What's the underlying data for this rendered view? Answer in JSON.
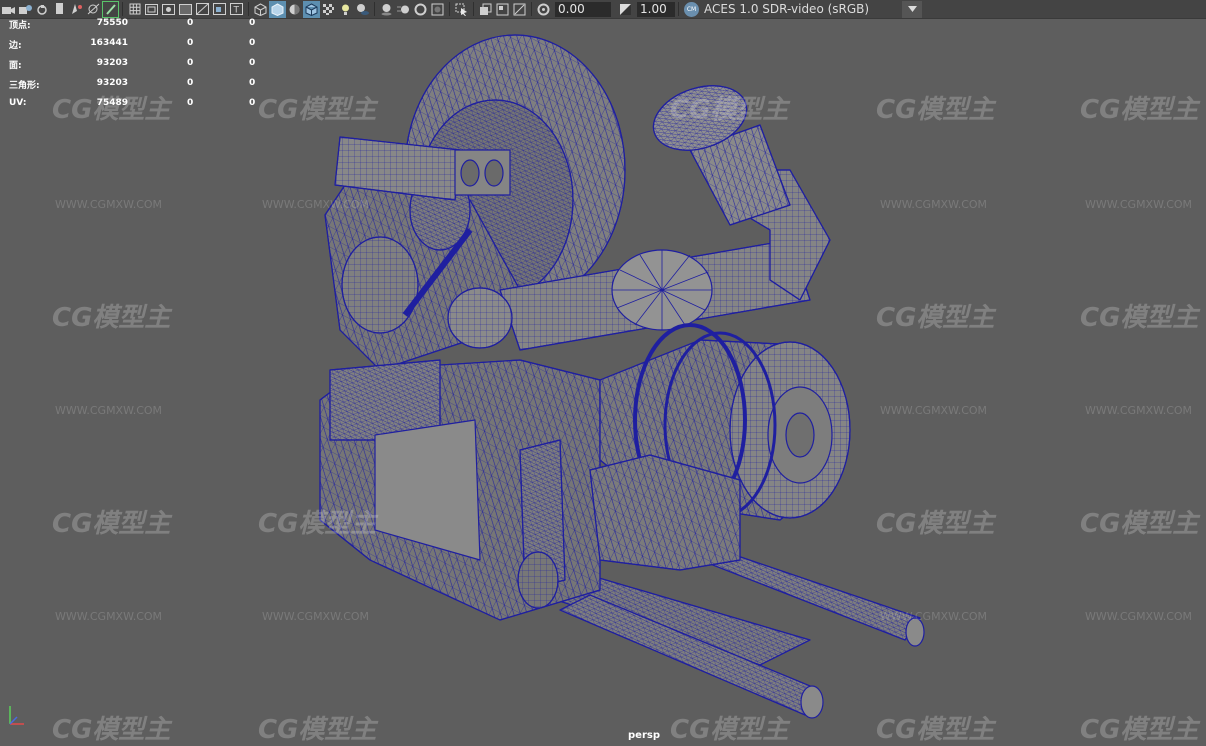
{
  "toolbar": {
    "exposure_value": "0.00",
    "gamma_value": "1.00",
    "color_space_badge": "CM",
    "color_space": "ACES 1.0 SDR-video (sRGB)",
    "icons": [
      "camera-icon",
      "camera-attribute-icon",
      "bookmark-icon",
      "image-plane-icon",
      "2d-pan-icon",
      "grease-pencil-icon",
      "grid-icon",
      "film-gate-icon",
      "resolution-gate-icon",
      "gate-mask-icon",
      "field-chart-icon",
      "safe-action-icon",
      "safe-title-icon",
      "wireframe-icon",
      "smooth-shade-icon",
      "use-default-material-icon",
      "wireframe-on-shaded-icon",
      "xray-icon",
      "lights-icon",
      "shadows-icon",
      "screen-space-ao-icon",
      "motion-blur-icon",
      "multisample-aa-icon",
      "depth-of-field-icon",
      "isolate-select-icon",
      "xray-joints-icon",
      "xray-active-icon",
      "two-sided-lighting-icon",
      "exposure-icon",
      "gamma-icon",
      "color-management-icon"
    ],
    "accent_active": "#59c36a",
    "accent_on": "#5d8fb0"
  },
  "hud": {
    "rows": [
      {
        "label": "顶点:",
        "v1": "75550",
        "v2": "0",
        "v3": "0"
      },
      {
        "label": "边:",
        "v1": "163441",
        "v2": "0",
        "v3": "0"
      },
      {
        "label": "面:",
        "v1": "93203",
        "v2": "0",
        "v3": "0"
      },
      {
        "label": "三角形:",
        "v1": "93203",
        "v2": "0",
        "v3": "0"
      },
      {
        "label": "UV:",
        "v1": "75489",
        "v2": "0",
        "v3": "0"
      }
    ]
  },
  "viewport": {
    "camera_name": "persp",
    "background_color": "#5e5e5e",
    "wireframe_color": "#1f1fa0",
    "watermark_logo": "CG模型主",
    "watermark_url": "WWW.CGMXW.COM"
  }
}
